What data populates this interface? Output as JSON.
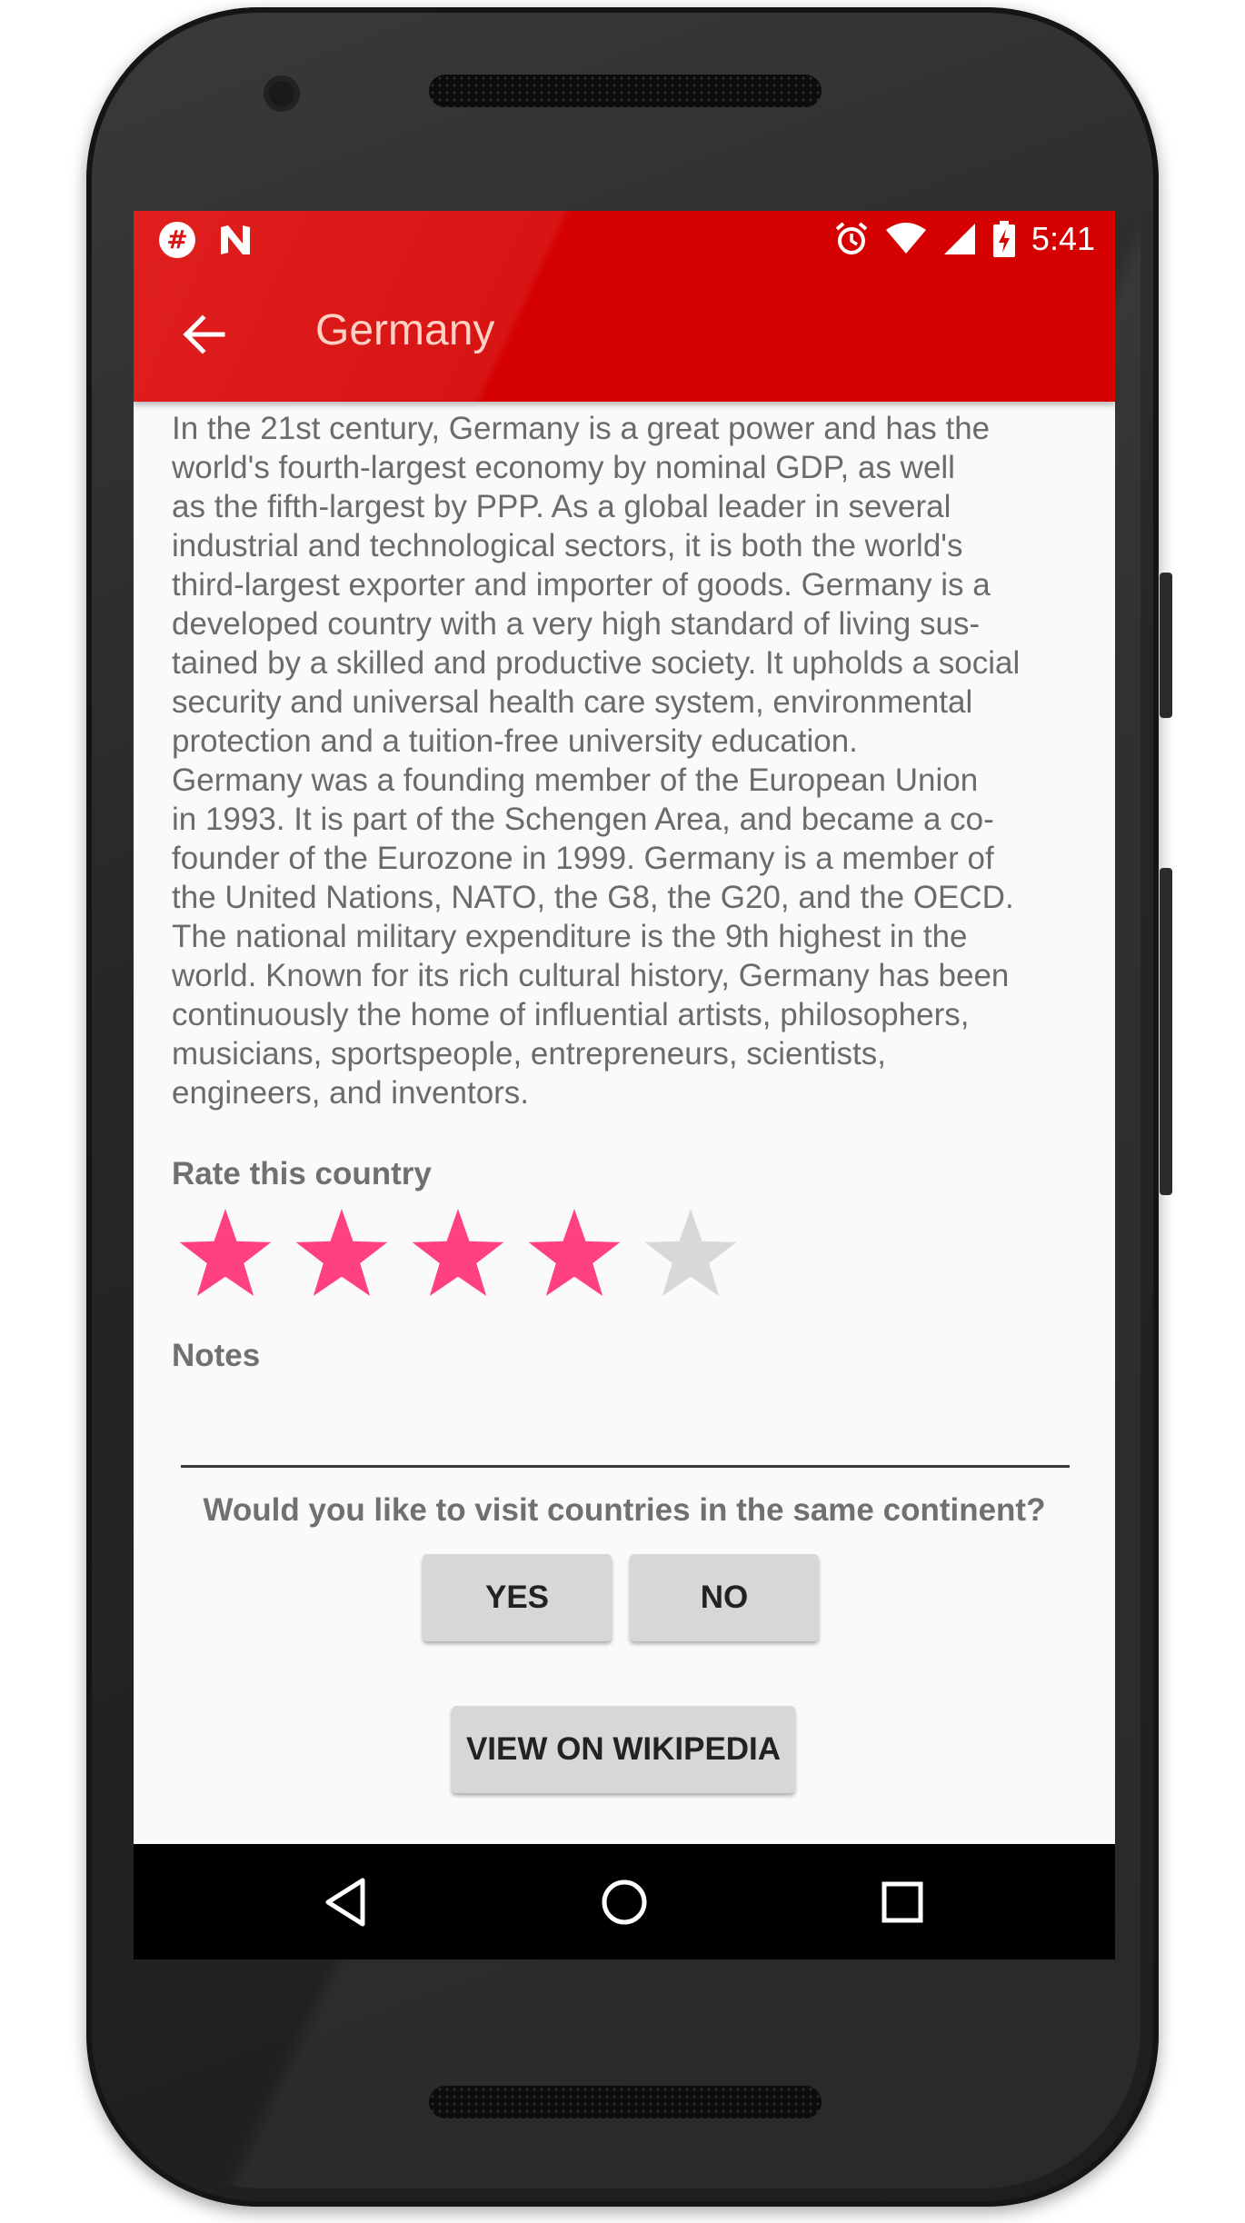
{
  "status_bar": {
    "time": "5:41",
    "left_icons": [
      "slack-notification-icon",
      "n-notification-icon"
    ],
    "right_icons": [
      "alarm-icon",
      "wifi-icon",
      "cell-signal-icon",
      "battery-charging-icon"
    ]
  },
  "toolbar": {
    "title": "Germany",
    "color": "#d50000"
  },
  "content": {
    "description": "In the 21st century, Germany is a great power and has the\nworld's fourth-largest economy by nominal GDP, as well\nas the fifth-largest by PPP. As a global leader in several\nindustrial and technological sectors, it is both the world's\nthird-largest exporter and importer of goods. Germany is a\ndeveloped country with a very high standard of living sus-\ntained by a skilled and productive society. It upholds a social\nsecurity and universal health care system, environmental\nprotection and a tuition-free university education.\nGermany was a founding member of the European Union\nin 1993. It is part of the Schengen Area, and became a co-\nfounder of the Eurozone in 1999. Germany is a member of\nthe United Nations, NATO, the G8, the G20, and the OECD.\nThe national military expenditure is the 9th highest in the\nworld. Known for its rich cultural history, Germany has been\ncontinuously the home of influential artists, philosophers,\nmusicians, sportspeople, entrepreneurs, scientists,\nengineers, and inventors.",
    "rating_label": "Rate this country",
    "rating": {
      "value": 4,
      "max": 5,
      "filled_color": "#ff4081",
      "empty_color": "#d8d8d8"
    },
    "notes_label": "Notes",
    "notes_value": "",
    "question": "Would you like to visit countries in the same continent?",
    "yes_label": "YES",
    "no_label": "NO",
    "wikipedia_label": "VIEW ON WIKIPEDIA"
  }
}
